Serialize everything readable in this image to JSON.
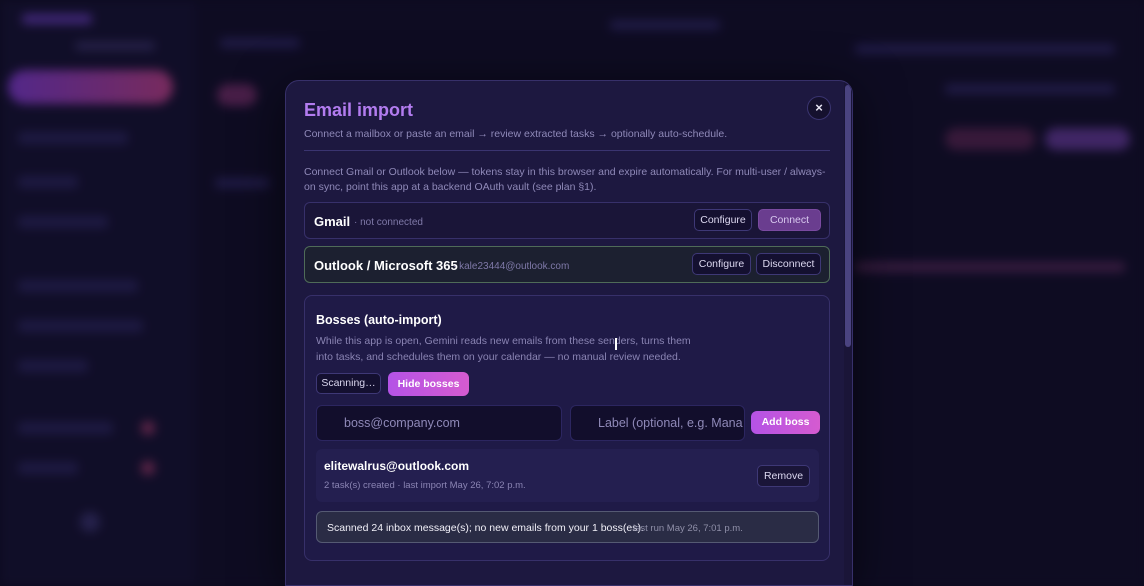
{
  "modal": {
    "title": "Email import",
    "subtitle": "Connect a mailbox or paste an email → review extracted tasks → optionally auto-schedule.",
    "close_label": "×",
    "intro": "Connect Gmail or Outlook below — tokens stay in this browser and expire automatically. For multi-user / always-on sync, point this app at a backend OAuth vault (see plan §1)."
  },
  "providers": [
    {
      "name": "Gmail",
      "status": "· not connected",
      "configure_label": "Configure",
      "action_label": "Connect"
    },
    {
      "name": "Outlook / Microsoft 365",
      "status": "· kale23444@outlook.com",
      "configure_label": "Configure",
      "action_label": "Disconnect"
    }
  ],
  "bosses": {
    "title": "Bosses (auto-import)",
    "description": "While this app is open, Gemini reads new emails from these senders, turns them into tasks, and schedules them on your calendar — no manual review needed.",
    "scan_label": "Scanning…",
    "hide_label": "Hide bosses",
    "email_placeholder": "boss@company.com",
    "label_placeholder": "Label (optional, e.g. Mana",
    "add_label": "Add boss",
    "list": [
      {
        "email": "elitewalrus@outlook.com",
        "meta": "2 task(s) created · last import May 26, 7:02 p.m.",
        "remove_label": "Remove"
      }
    ],
    "scan_result": "Scanned 24 inbox message(s); no new emails from your 1 boss(es).",
    "scan_time": "last run May 26, 7:01 p.m."
  },
  "colors": {
    "accent": "#b37cf0",
    "gradient_start": "#b453e6",
    "gradient_end": "#d55bd0",
    "modal_bg": "#1d1840",
    "page_bg": "#0d0b1f"
  }
}
